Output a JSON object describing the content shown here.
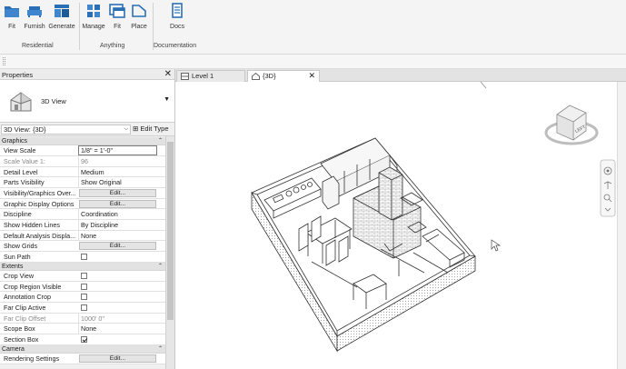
{
  "ribbon": {
    "buttons": [
      {
        "label": "Fit",
        "icon": "folder-blue-icon"
      },
      {
        "label": "Furnish",
        "icon": "sofa-icon"
      },
      {
        "label": "Generate",
        "icon": "layout-generate-icon"
      },
      {
        "label": "Manage",
        "icon": "grid-manage-icon"
      },
      {
        "label": "Fit",
        "icon": "nested-windows-icon"
      },
      {
        "label": "Place",
        "icon": "tag-place-icon"
      },
      {
        "label": "Docs",
        "icon": "document-icon"
      }
    ],
    "groups": [
      "Residential",
      "Anything",
      "Documentation"
    ]
  },
  "properties": {
    "title": "Properties",
    "type_name": "3D View",
    "view_selector": "3D View: {3D}",
    "edit_type": "Edit Type",
    "sections": {
      "graphics": "Graphics",
      "extents": "Extents",
      "camera": "Camera"
    },
    "rows": {
      "view_scale": {
        "name": "View Scale",
        "value": "1/8\" = 1'-0\""
      },
      "scale_value": {
        "name": "Scale Value    1:",
        "value": "96"
      },
      "detail_level": {
        "name": "Detail Level",
        "value": "Medium"
      },
      "parts_visibility": {
        "name": "Parts Visibility",
        "value": "Show Original"
      },
      "vg_overrides": {
        "name": "Visibility/Graphics Over...",
        "value": "Edit..."
      },
      "graphic_display": {
        "name": "Graphic Display Options",
        "value": "Edit..."
      },
      "discipline": {
        "name": "Discipline",
        "value": "Coordination"
      },
      "hidden_lines": {
        "name": "Show Hidden Lines",
        "value": "By Discipline"
      },
      "analysis_display": {
        "name": "Default Analysis Displa...",
        "value": "None"
      },
      "show_grids": {
        "name": "Show Grids",
        "value": "Edit..."
      },
      "sun_path": {
        "name": "Sun Path",
        "checked": false
      },
      "crop_view": {
        "name": "Crop View",
        "checked": false
      },
      "crop_region_visible": {
        "name": "Crop Region Visible",
        "checked": false
      },
      "annotation_crop": {
        "name": "Annotation Crop",
        "checked": false
      },
      "far_clip_active": {
        "name": "Far Clip Active",
        "checked": false
      },
      "far_clip_offset": {
        "name": "Far Clip Offset",
        "value": "1000'  0\""
      },
      "scope_box": {
        "name": "Scope Box",
        "value": "None"
      },
      "section_box": {
        "name": "Section Box",
        "checked": true
      },
      "rendering_settings": {
        "name": "Rendering Settings",
        "value": "Edit..."
      }
    }
  },
  "tabs": [
    {
      "label": "Level 1",
      "active": false
    },
    {
      "label": "{3D}",
      "active": true
    }
  ],
  "viewcube": {
    "face_label": "LEFT"
  },
  "colors": {
    "ribbon_blue": "#2a6fb5",
    "panel_bg": "#f0f0f0",
    "section_bg": "#e2e2e2"
  }
}
